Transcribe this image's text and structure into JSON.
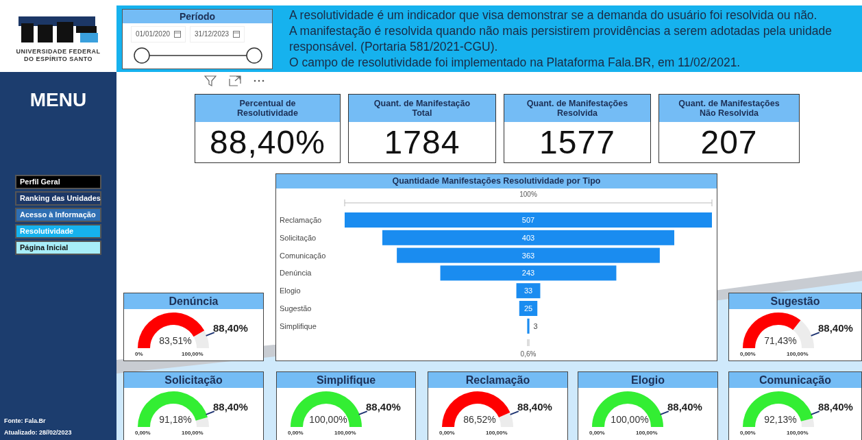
{
  "logo": {
    "lines": [
      "UNIVERSIDADE FEDERAL",
      "DO ESPÍRITO SANTO"
    ]
  },
  "period_slicer": {
    "title": "Período",
    "start_date": "01/01/2020",
    "end_date": "31/12/2023",
    "range": {
      "level": 1
    }
  },
  "description": [
    "A resolutividade é um indicador que visa demonstrar se a demanda do usuário foi resolvida ou não.",
    "A manifestação é resolvida quando não mais persistirem providências a serem adotadas pela unidade responsável. (Portaria 581/2021-CGU).",
    "O campo de resolutividade foi implementado na Plataforma Fala.BR, em 11/02/2021."
  ],
  "sidebar": {
    "title": "MENU",
    "items": [
      {
        "label": "Perfil Geral",
        "color": "#000000"
      },
      {
        "label": "Ranking das Unidades",
        "color": "#1c3766"
      },
      {
        "label": "Acesso à Informação",
        "color": "#2f6fb3"
      },
      {
        "label": "Resolutividade",
        "color": "#16b2ee"
      },
      {
        "label": "Página Inicial",
        "color": "#a8eef8"
      }
    ],
    "footer": [
      "Fonte: Fala.Br",
      "Atualizado: 28//02/2023"
    ]
  },
  "kpis": [
    {
      "title": "Percentual de Resolutividade",
      "value": "88,40%"
    },
    {
      "title": "Quant. de Manifestação Total",
      "value": "1784"
    },
    {
      "title": "Quant. de Manifestações Resolvida",
      "value": "1577"
    },
    {
      "title": "Quant. de Manifestações Não Resolvida",
      "value": "207"
    }
  ],
  "funnel": {
    "title": "Quantidade Manifestações Resolutividade por Tipo",
    "top_label": "100%",
    "bottom_label": "0,6%",
    "stages": [
      {
        "label": "Reclamação",
        "value": "507"
      },
      {
        "label": "Solicitação",
        "value": "403"
      },
      {
        "label": "Comunicação",
        "value": "363"
      },
      {
        "label": "Denúncia",
        "value": "243"
      },
      {
        "label": "Elogio",
        "value": "33"
      },
      {
        "label": "Sugestão",
        "value": "25"
      },
      {
        "label": "Simplifique",
        "value": "3"
      }
    ]
  },
  "gauges": [
    {
      "title": "Denúncia",
      "value": "83,51%",
      "level": 0.8351,
      "color": "#ff0000",
      "min": "0%",
      "max": "100,00%",
      "target": {
        "label": "88,40%",
        "level": 0.884
      }
    },
    {
      "title": "Sugestão",
      "value": "71,43%",
      "level": 0.7143,
      "color": "#ff0000",
      "min": "0,00%",
      "max": "100,00%",
      "target": {
        "label": "88,40%",
        "level": 0.884
      }
    },
    {
      "title": "Solicitação",
      "value": "91,18%",
      "level": 0.9118,
      "color": "#33ee33",
      "min": "0,00%",
      "max": "100,00%",
      "target": {
        "label": "88,40%",
        "level": 0.884
      }
    },
    {
      "title": "Simplifique",
      "value": "100,00%",
      "level": 1,
      "color": "#33ee33",
      "min": "0,00%",
      "max": "100,00%",
      "target": {
        "label": "88,40%",
        "level": 0.884
      }
    },
    {
      "title": "Reclamação",
      "value": "86,52%",
      "level": 0.8652,
      "color": "#ff0000",
      "min": "0,00%",
      "max": "100,00%",
      "target": {
        "label": "88,40%",
        "level": 0.884
      }
    },
    {
      "title": "Elogio",
      "value": "100,00%",
      "level": 1,
      "color": "#33ee33",
      "min": "0,00%",
      "max": "100,00%",
      "target": {
        "label": "88,40%",
        "level": 0.884
      }
    },
    {
      "title": "Comunicação",
      "value": "92,13%",
      "level": 0.9213,
      "color": "#33ee33",
      "min": "0,00%",
      "max": "100,00%",
      "target": {
        "label": "88,40%",
        "level": 0.884
      }
    }
  ]
}
